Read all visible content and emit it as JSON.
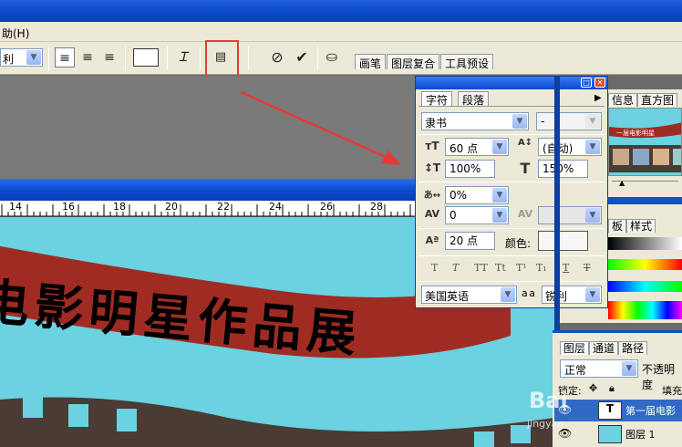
{
  "menubar": {
    "partial_item": "助(H)"
  },
  "options": {
    "font_style": "利",
    "dock_tabs": [
      "画笔",
      "图层复合",
      "工具预设"
    ]
  },
  "ruler": {
    "ticks": [
      "14",
      "16",
      "18",
      "20",
      "22",
      "24",
      "26",
      "28"
    ]
  },
  "canvas": {
    "banner_text": "电影明星作品展"
  },
  "char_panel": {
    "tabs": [
      "字符",
      "段落"
    ],
    "font_family": "隶书",
    "font_style": "-",
    "font_size": "60 点",
    "leading": "(自动)",
    "vertical_scale": "100%",
    "horizontal_scale": "150%",
    "tsume": "0%",
    "kerning": "0",
    "baseline_shift": "20 点",
    "color_label": "颜色:",
    "language": "美国英语",
    "aa_label": "a a",
    "antialias": "锐利",
    "style_buttons": [
      "T",
      "T",
      "TT",
      "Tt",
      "T¹",
      "T₁",
      "T",
      "T"
    ]
  },
  "navigator": {
    "tabs": [
      "信息",
      "直方图"
    ],
    "thumb_text": "一届电影明星"
  },
  "mid_panel": {
    "tabs": [
      "板",
      "样式"
    ]
  },
  "layers": {
    "tabs": [
      "图层",
      "通道",
      "路径"
    ],
    "blend_mode": "正常",
    "opacity_label": "不透明度",
    "lock_label": "锁定:",
    "fill_label": "填充",
    "rows": [
      {
        "name": "第一届电影"
      },
      {
        "name": "图层 1"
      }
    ]
  },
  "watermark": {
    "text": "Bai",
    "sub": "jingyan"
  }
}
